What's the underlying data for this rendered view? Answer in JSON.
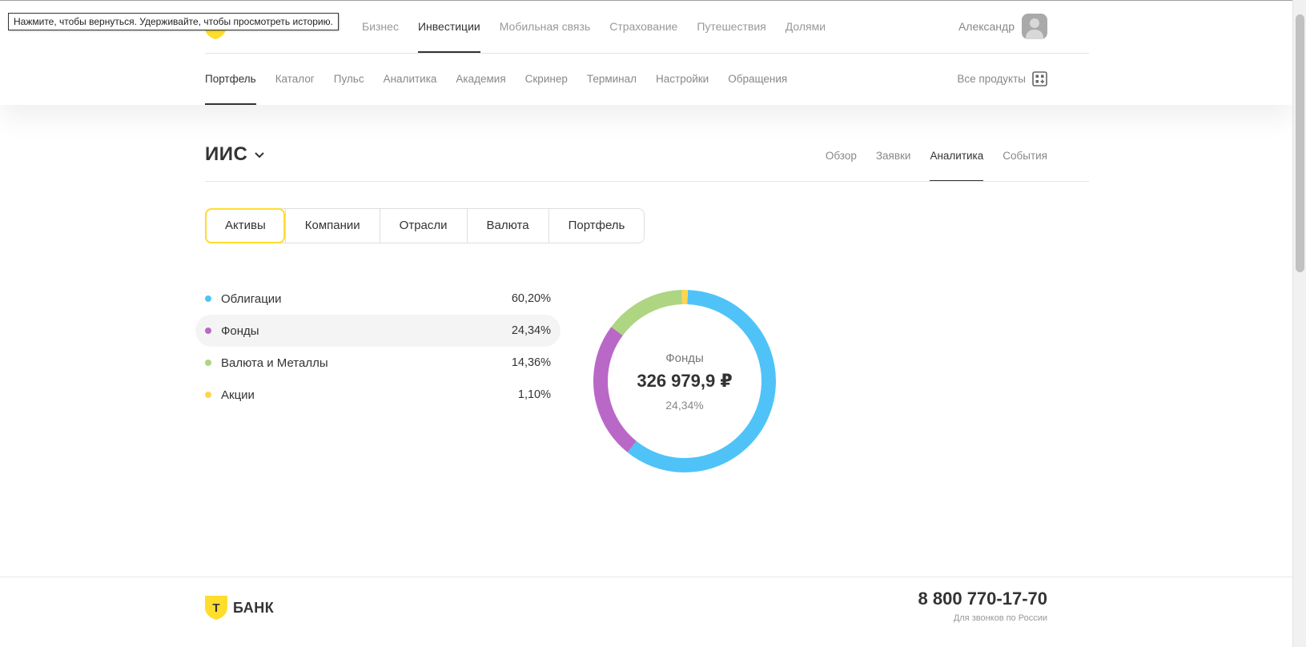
{
  "tooltip": "Нажмите, чтобы вернуться. Удерживайте, чтобы просмотреть историю.",
  "header": {
    "top_nav": [
      "Бизнес",
      "Инвестиции",
      "Мобильная связь",
      "Страхование",
      "Путешествия",
      "Долями"
    ],
    "top_nav_active": "Инвестиции",
    "user_name": "Александр",
    "sub_nav": [
      "Портфель",
      "Каталог",
      "Пульс",
      "Аналитика",
      "Академия",
      "Скринер",
      "Терминал",
      "Настройки",
      "Обращения"
    ],
    "sub_nav_active": "Портфель",
    "all_products": "Все продукты"
  },
  "account": {
    "title": "ИИС",
    "tabs": [
      "Обзор",
      "Заявки",
      "Аналитика",
      "События"
    ],
    "active_tab": "Аналитика"
  },
  "segments": {
    "items": [
      "Активы",
      "Компании",
      "Отрасли",
      "Валюта",
      "Портфель"
    ],
    "active": "Активы"
  },
  "legend": [
    {
      "label": "Облигации",
      "pct": "60,20%",
      "color": "#4fc3f7"
    },
    {
      "label": "Фонды",
      "pct": "24,34%",
      "color": "#ba68c8"
    },
    {
      "label": "Валюта и Металлы",
      "pct": "14,36%",
      "color": "#aed581"
    },
    {
      "label": "Акции",
      "pct": "1,10%",
      "color": "#ffd54f"
    }
  ],
  "highlighted_index": 1,
  "chart_data": {
    "type": "pie",
    "categories": [
      "Облигации",
      "Фонды",
      "Валюта и Металлы",
      "Акции"
    ],
    "values": [
      60.2,
      24.34,
      14.36,
      1.1
    ],
    "colors": [
      "#4fc3f7",
      "#ba68c8",
      "#aed581",
      "#ffd54f"
    ],
    "donut": true
  },
  "donut_center": {
    "category": "Фонды",
    "amount": "326 979,9 ₽",
    "share": "24,34%"
  },
  "footer": {
    "brand": "БАНК",
    "logo_letter": "Т",
    "phone": "8 800 770-17-70",
    "phone_hint": "Для звонков по России"
  },
  "colors": {
    "brand_yellow": "#ffdd2d"
  }
}
